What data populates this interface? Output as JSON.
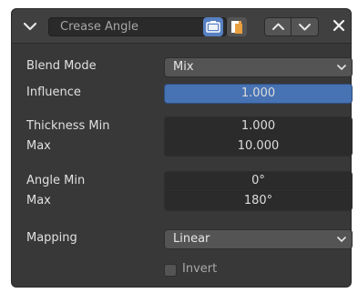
{
  "header": {
    "name_value": "Crease Angle"
  },
  "rows": {
    "blend_mode": {
      "label": "Blend Mode",
      "value": "Mix"
    },
    "influence": {
      "label": "Influence",
      "value": "1.000"
    },
    "thickness_min": {
      "label": "Thickness Min",
      "value": "1.000"
    },
    "thickness_max": {
      "label": "Max",
      "value": "10.000"
    },
    "angle_min": {
      "label": "Angle Min",
      "value": "0°"
    },
    "angle_max": {
      "label": "Max",
      "value": "180°"
    },
    "mapping": {
      "label": "Mapping",
      "value": "Linear"
    },
    "invert": {
      "label": "Invert",
      "checked": false
    }
  },
  "icons": {
    "collapse": "chevron-down-icon",
    "render": "camera-icon",
    "edit": "edit-mode-icon",
    "move_up": "chevron-up-icon",
    "move_down": "chevron-down-icon",
    "close": "close-icon",
    "dropdown": "chevron-down-icon"
  },
  "colors": {
    "panel_bg": "#383838",
    "header_bg": "#404040",
    "field_bg": "#545454",
    "field_dark": "#2b2b2b",
    "accent": "#4772b3",
    "edit_icon": "#e8a040"
  }
}
